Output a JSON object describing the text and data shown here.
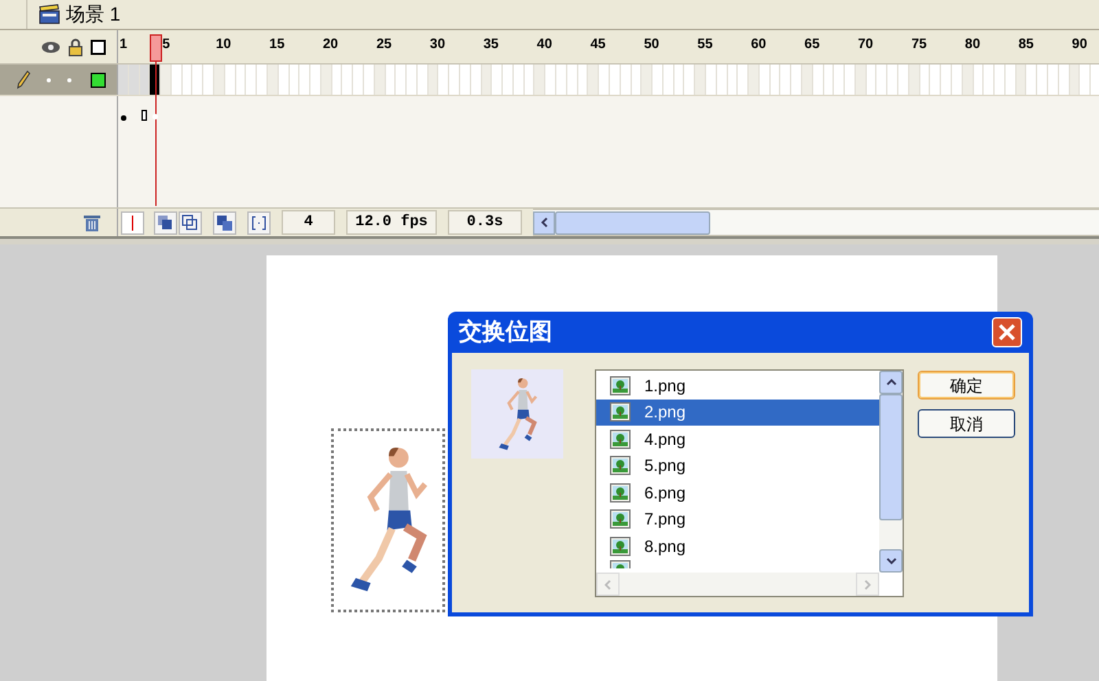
{
  "scene_bar": {
    "title": "场景 1"
  },
  "timeline": {
    "ruler_labels": [
      "1",
      "5",
      "10",
      "15",
      "20",
      "25",
      "30",
      "35",
      "40",
      "45",
      "50",
      "55",
      "60",
      "65",
      "70",
      "75",
      "80",
      "85",
      "90"
    ],
    "layers": [
      {
        "selected": true,
        "color": "#33dd33"
      }
    ],
    "status": {
      "frame": "4",
      "fps": "12.0 fps",
      "time": "0.3s"
    }
  },
  "dialog": {
    "title": "交换位图",
    "files": [
      {
        "name": "1.png",
        "selected": false
      },
      {
        "name": "2.png",
        "selected": true
      },
      {
        "name": "4.png",
        "selected": false
      },
      {
        "name": "5.png",
        "selected": false
      },
      {
        "name": "6.png",
        "selected": false
      },
      {
        "name": "7.png",
        "selected": false
      },
      {
        "name": "8.png",
        "selected": false
      }
    ],
    "buttons": [
      "确定",
      "取消"
    ]
  }
}
